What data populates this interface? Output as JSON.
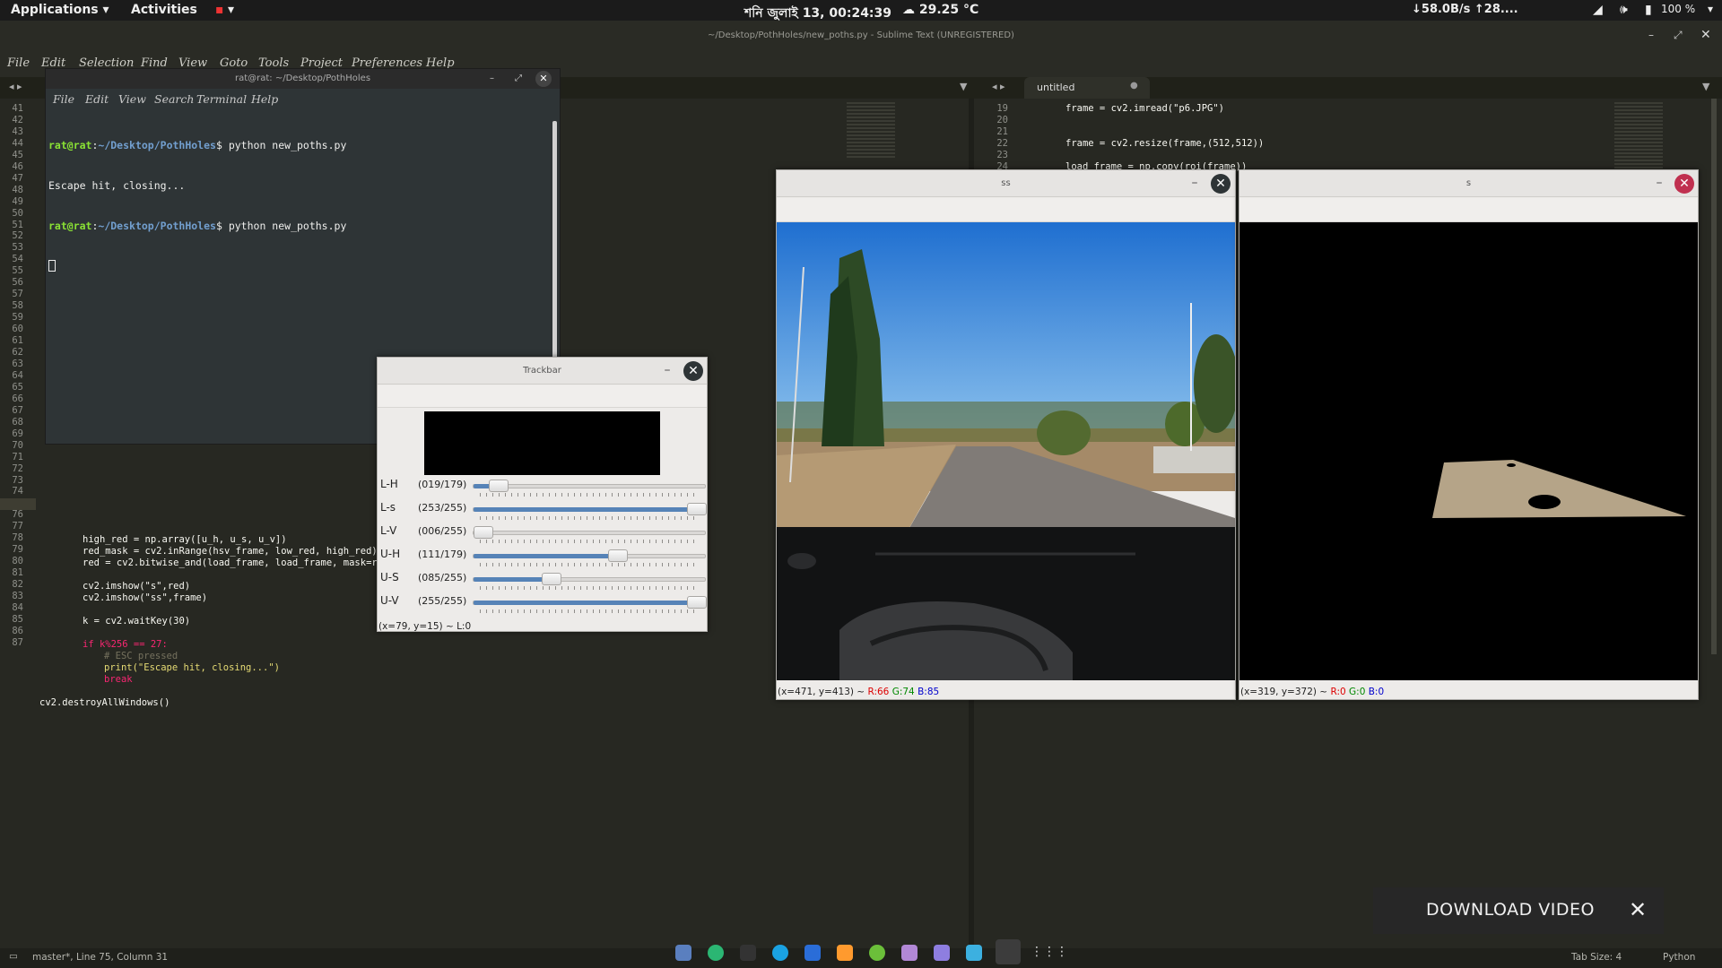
{
  "topbar": {
    "applications": "Applications",
    "activities": "Activities",
    "clock": "শনি জুলাই 13, 00:24:39",
    "weather": "29.25 °C",
    "net": "↓58.0B/s ↑28....",
    "battery": "100 %"
  },
  "sublime": {
    "title": "~/Desktop/PothHoles/new_poths.py - Sublime Text (UNREGISTERED)",
    "menu": [
      "File",
      "Edit",
      "Selection",
      "Find",
      "View",
      "Goto",
      "Tools",
      "Project",
      "Preferences",
      "Help"
    ],
    "right_tab": "untitled",
    "status_left": "master*, Line 75, Column 31",
    "tab_size": "Tab Size: 4",
    "syntax": "Python"
  },
  "left_editor": {
    "gutter_lines": [
      "41",
      "42",
      "43",
      "44",
      "45",
      "46",
      "47",
      "48",
      "49",
      "50",
      "51",
      "52",
      "53",
      "54",
      "55",
      "56",
      "57",
      "58",
      "59",
      "60",
      "61",
      "62",
      "63",
      "64",
      "65",
      "66",
      "67",
      "68",
      "69",
      "70",
      "71",
      "72",
      "73",
      "74",
      "75",
      "76",
      "77",
      "78",
      "79",
      "80",
      "81",
      "82",
      "83",
      "84",
      "85",
      "86",
      "87"
    ],
    "code_70": "high_red = np.array([u_h, u_s, u_v])",
    "code_71": "red_mask = cv2.inRange(hsv_frame, low_red, high_red)",
    "code_72": "red = cv2.bitwise_and(load_frame, load_frame, mask=red",
    "code_74": "cv2.imshow(\"s\",red)",
    "code_75": "cv2.imshow(\"ss\",frame)",
    "code_77": "k = cv2.waitKey(30)",
    "code_79": "if k%256 == 27:",
    "code_80": "# ESC pressed",
    "code_81": "print(\"Escape hit, closing...\")",
    "code_82": "break",
    "code_84": "cv2.destroyAllWindows()"
  },
  "right_editor": {
    "gutter_lines": [
      "19",
      "20",
      "21",
      "22",
      "23",
      "24"
    ],
    "code_19": "frame = cv2.imread(\"p6.JPG\")",
    "code_22": "frame = cv2.resize(frame,(512,512))",
    "code_24": "load_frame = np.copy(roi(frame))"
  },
  "terminal": {
    "title": "rat@rat: ~/Desktop/PothHoles",
    "menu": [
      "File",
      "Edit",
      "View",
      "Search",
      "Terminal",
      "Help"
    ],
    "prompt_user": "rat@rat",
    "prompt_path": "~/Desktop/PothHoles",
    "cmd1": "python new_poths.py",
    "output1": "Escape hit, closing...",
    "cmd2": "python new_poths.py"
  },
  "trackbar": {
    "title": "Trackbar",
    "sliders": [
      {
        "label": "L-H",
        "value": "(019/179)",
        "fraction": 0.106
      },
      {
        "label": "L-s",
        "value": "(253/255)",
        "fraction": 0.992
      },
      {
        "label": "L-V",
        "value": "(006/255)",
        "fraction": 0.024
      },
      {
        "label": "U-H",
        "value": "(111/179)",
        "fraction": 0.62
      },
      {
        "label": "U-S",
        "value": "(085/255)",
        "fraction": 0.333
      },
      {
        "label": "U-V",
        "value": "(255/255)",
        "fraction": 1.0
      }
    ],
    "status": "(x=79, y=15) ~ L:0"
  },
  "ss_window": {
    "title": "ss",
    "status_prefix": "(x=471, y=413) ~",
    "r": "R:66",
    "g": "G:74",
    "b": "B:85"
  },
  "s_window": {
    "title": "s",
    "status_prefix": "(x=319, y=372) ~",
    "r": "R:0",
    "g": "G:0",
    "b": "B:0"
  },
  "overlay": {
    "download": "DOWNLOAD VIDEO"
  },
  "colors": {
    "sublime_bg": "#272822",
    "keyword": "#f92672",
    "function": "#66d9ef",
    "string": "#e6db74",
    "comment": "#75715e",
    "number": "#ae81ff"
  }
}
